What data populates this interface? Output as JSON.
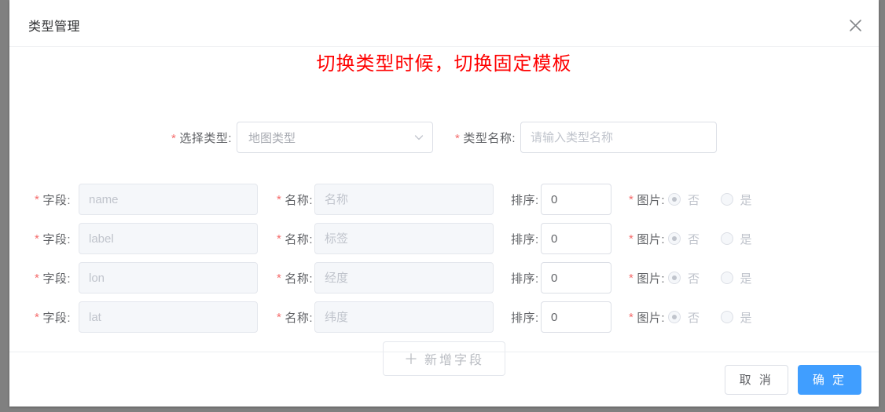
{
  "dialog": {
    "title": "类型管理",
    "close_icon": "close-icon",
    "note": "切换类型时候，切换固定模板"
  },
  "top_form": {
    "select_type": {
      "required_mark": "*",
      "label": "选择类型:",
      "value": "地图类型",
      "caret_icon": "chevron-down-icon"
    },
    "type_name": {
      "required_mark": "*",
      "label": "类型名称:",
      "value": "",
      "placeholder": "请输入类型名称"
    }
  },
  "column_labels": {
    "field": "字段:",
    "name": "名称:",
    "sort": "排序:",
    "image": "图片:",
    "required_mark": "*"
  },
  "radio_options": {
    "no": "否",
    "yes": "是"
  },
  "rows": [
    {
      "field": "name",
      "name": "名称",
      "sort": "0",
      "image": "否"
    },
    {
      "field": "label",
      "name": "标签",
      "sort": "0",
      "image": "否"
    },
    {
      "field": "lon",
      "name": "经度",
      "sort": "0",
      "image": "否"
    },
    {
      "field": "lat",
      "name": "纬度",
      "sort": "0",
      "image": "否"
    }
  ],
  "add_field_button": {
    "plus": "＋",
    "label": "新增字段"
  },
  "footer": {
    "cancel": "取 消",
    "confirm": "确 定"
  },
  "colors": {
    "primary": "#409eff",
    "required": "#f56c6c",
    "note": "#ff0000",
    "border": "#dcdfe6",
    "disabled_bg": "#f5f7fa",
    "text": "#606266"
  }
}
